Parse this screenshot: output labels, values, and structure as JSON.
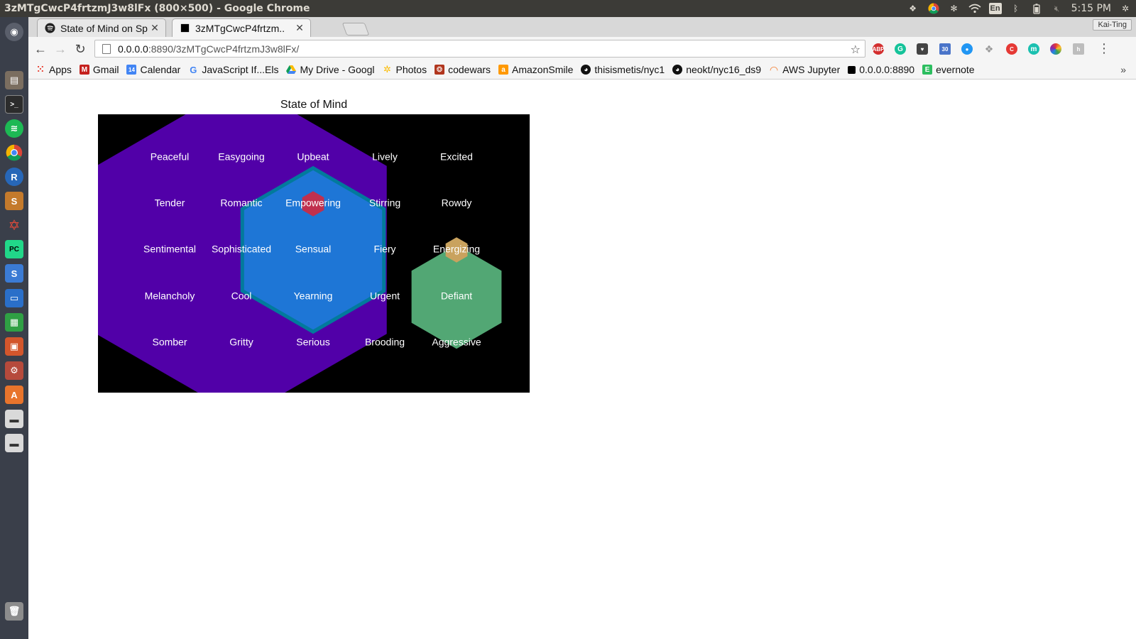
{
  "os": {
    "window_title": "3zMTgCwcP4frtzmJ3w8lFx (800×500) - Google Chrome",
    "tray": {
      "lang": "En",
      "clock": "5:15 PM"
    },
    "launcher": [
      {
        "name": "ubuntu-dash-icon"
      },
      {
        "name": "files-icon"
      },
      {
        "name": "terminal-icon"
      },
      {
        "name": "spotify-icon"
      },
      {
        "name": "chrome-icon"
      },
      {
        "name": "r-icon"
      },
      {
        "name": "sublime-icon"
      },
      {
        "name": "network-icon"
      },
      {
        "name": "pycharm-icon"
      },
      {
        "name": "sqlitebrowser-icon"
      },
      {
        "name": "writer-icon"
      },
      {
        "name": "calc-icon"
      },
      {
        "name": "impress-icon"
      },
      {
        "name": "settings-icon"
      },
      {
        "name": "software-center-icon"
      },
      {
        "name": "drive-icon"
      },
      {
        "name": "drive-icon"
      },
      {
        "name": "trash-icon"
      }
    ]
  },
  "browser": {
    "tabs": [
      {
        "title": "State of Mind on Sp",
        "icon": "spotify-icon",
        "active": false
      },
      {
        "title": "3zMTgCwcP4frtzm..",
        "icon": "page-icon",
        "active": true
      }
    ],
    "profile": "Kai-Ting",
    "url_host": "0.0.0.0",
    "url_rest": ":8890/3zMTgCwcP4frtzmJ3w8lFx/",
    "bookmarks": [
      {
        "label": "Apps",
        "icon": "apps-grid-icon",
        "color": "#e94235"
      },
      {
        "label": "Gmail",
        "icon": "gmail-icon",
        "color": "#c5221f"
      },
      {
        "label": "Calendar",
        "icon": "calendar-icon",
        "color": "#4285f4",
        "badge": "14"
      },
      {
        "label": "JavaScript If...Els",
        "icon": "google-icon",
        "color": "#4285f4"
      },
      {
        "label": "My Drive - Googl",
        "icon": "drive-icon",
        "color": "#0f9d58"
      },
      {
        "label": "Photos",
        "icon": "photos-icon",
        "color": "#fbbc04"
      },
      {
        "label": "codewars",
        "icon": "codewars-icon",
        "color": "#b1361e"
      },
      {
        "label": "AmazonSmile",
        "icon": "amazon-icon",
        "color": "#ff9900"
      },
      {
        "label": "thisismetis/nyc1",
        "icon": "github-icon",
        "color": "#111111"
      },
      {
        "label": "neokt/nyc16_ds9",
        "icon": "github-icon",
        "color": "#111111"
      },
      {
        "label": "AWS Jupyter",
        "icon": "jupyter-icon",
        "color": "#f37726"
      },
      {
        "label": "0.0.0.0:8890",
        "icon": "page-icon",
        "color": "#000000"
      },
      {
        "label": "evernote",
        "icon": "evernote-icon",
        "color": "#2dbe60"
      }
    ],
    "more": "»"
  },
  "chart_data": {
    "type": "hexbin",
    "title": "State of Mind",
    "background": "#000000",
    "grid_rows": [
      [
        "Peaceful",
        "Easygoing",
        "Upbeat",
        "Lively",
        "Excited"
      ],
      [
        "Tender",
        "Romantic",
        "Empowering",
        "Stirring",
        "Rowdy"
      ],
      [
        "Sentimental",
        "Sophisticated",
        "Sensual",
        "Fiery",
        "Energizing"
      ],
      [
        "Melancholy",
        "Cool",
        "Yearning",
        "Urgent",
        "Defiant"
      ],
      [
        "Somber",
        "Gritty",
        "Serious",
        "Brooding",
        "Aggressive"
      ]
    ],
    "hexagons": [
      {
        "center": "Sophisticated",
        "size": 2.0,
        "color": "#5100a8"
      },
      {
        "center": "Sensual",
        "size": 1.0,
        "color": "#027a9c"
      },
      {
        "center": "Sensual",
        "size": 0.95,
        "color": "#1e76d6"
      },
      {
        "center": "Empowering",
        "size": 0.15,
        "color": "#c0304e"
      },
      {
        "center": "Defiant",
        "size": 0.62,
        "color": "#52a774"
      },
      {
        "center": "Energizing",
        "size": 0.15,
        "color": "#c9a25e"
      }
    ]
  }
}
